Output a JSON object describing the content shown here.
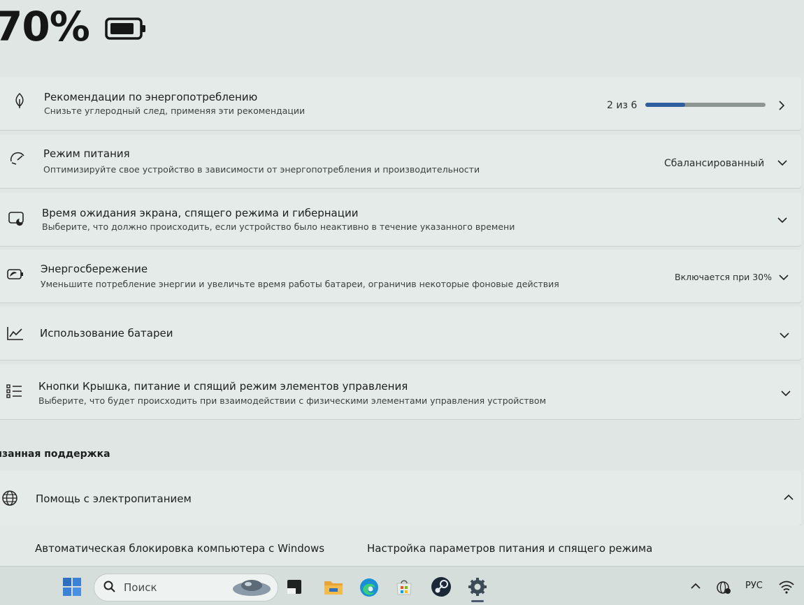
{
  "header": {
    "battery_percent": "70%",
    "battery_icon": "battery-icon"
  },
  "cards": [
    {
      "icon": "leaf-icon",
      "title": "Рекомендации по энергопотреблению",
      "subtitle": "Снизьте углеродный след, применяя эти рекомендации",
      "right_text": "2 из 6",
      "progress": 0.33,
      "control_icon": "chevron-right-icon"
    },
    {
      "icon": "speedometer-icon",
      "title": "Режим питания",
      "subtitle": "Оптимизируйте свое устройство в зависимости от энергопотребления и производительности",
      "right_text": "Сбалансированный",
      "control_icon": "chevron-down-icon"
    },
    {
      "icon": "screen-sleep-icon",
      "title": "Время ожидания экрана, спящего режима и гибернации",
      "subtitle": "Выберите, что должно происходить, если устройство было неактивно в течение указанного времени",
      "control_icon": "chevron-down-icon"
    },
    {
      "icon": "battery-saver-icon",
      "title": "Энергосбережение",
      "subtitle": "Уменьшите потребление энергии и увеличьте время работы батареи, ограничив некоторые фоновые действия",
      "right_text": "Включается при 30%",
      "control_icon": "chevron-down-icon"
    },
    {
      "icon": "chart-line-icon",
      "title": "Использование батареи",
      "control_icon": "chevron-down-icon"
    },
    {
      "icon": "list-icon",
      "title": "Кнопки Крышка, питание и спящий режим элементов управления",
      "subtitle": "Выберите, что будет происходить при взаимодействии с физическими элементами управления устройством",
      "control_icon": "chevron-down-icon"
    }
  ],
  "related_support": {
    "section_title": "язанная поддержка",
    "help_card": {
      "icon": "globe-icon",
      "title": "Помощь с электропитанием",
      "control_icon": "chevron-up-icon"
    },
    "links": [
      "Автоматическая блокировка компьютера с Windows",
      "Настройка параметров питания и спящего режима"
    ]
  },
  "taskbar": {
    "search_placeholder": "Поиск",
    "language": "РУС",
    "icons": [
      "windows-start-icon",
      "search-icon",
      "widget-icon",
      "app-icon",
      "file-explorer-icon",
      "edge-icon",
      "store-icon",
      "steam-icon",
      "settings-icon",
      "chevron-up-icon",
      "wifi-globe-icon",
      "wifi-icon"
    ]
  },
  "colors": {
    "accent": "#2f5e9e",
    "background": "#dfe6e3",
    "card": "#e5ebe8"
  }
}
